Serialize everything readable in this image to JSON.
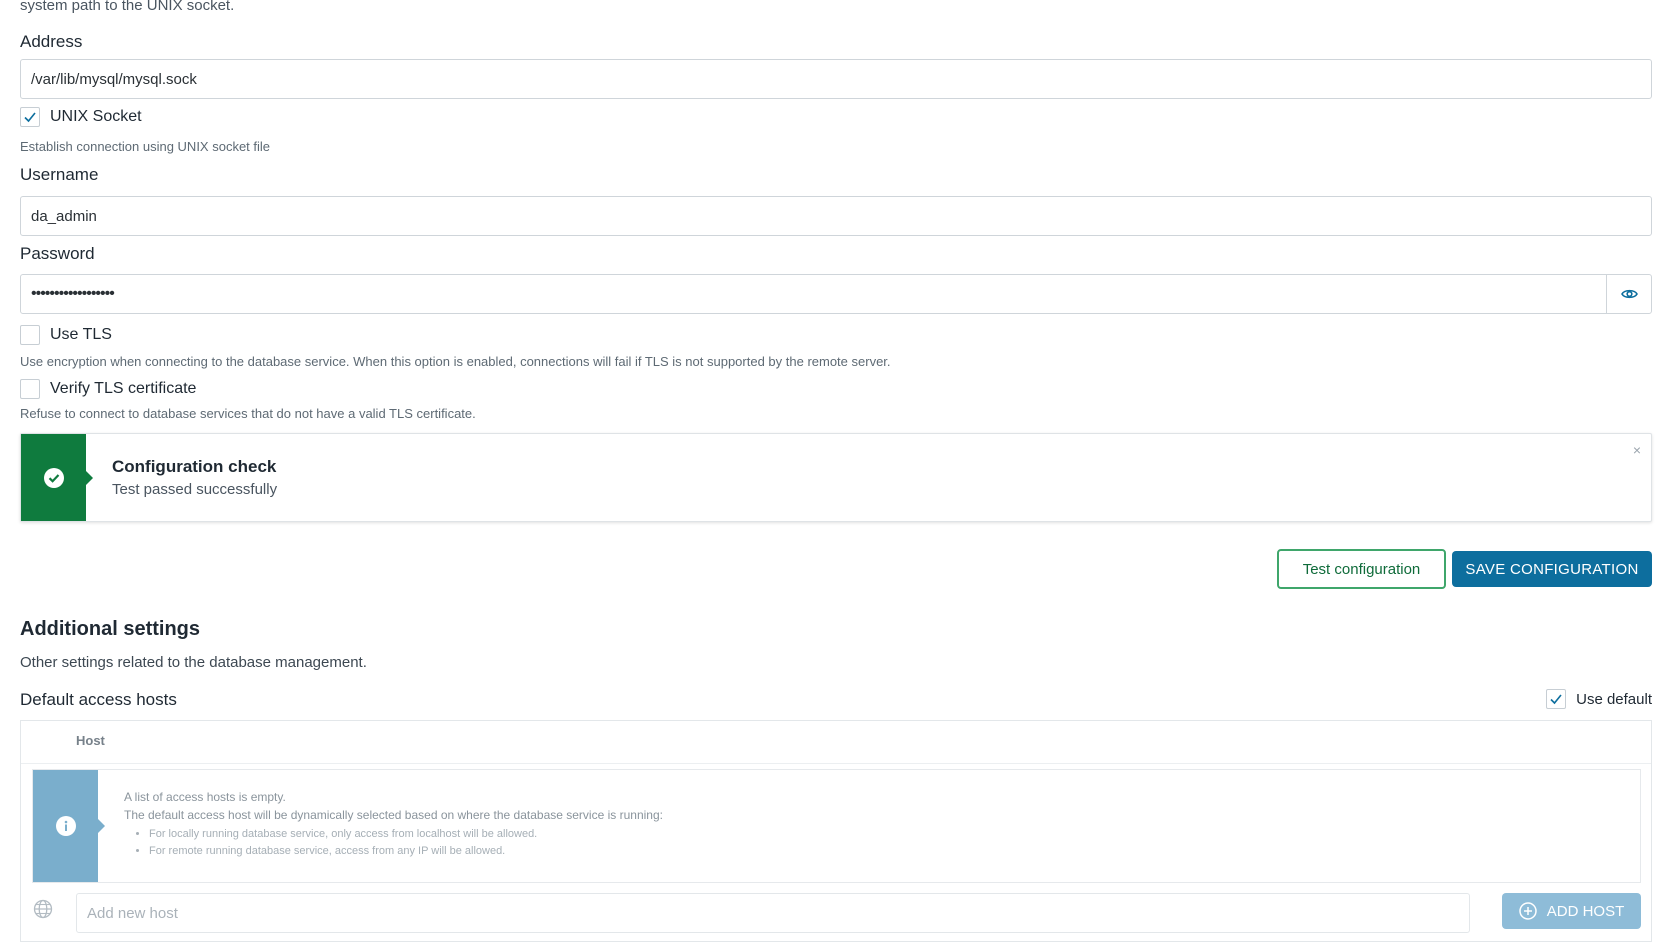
{
  "connection": {
    "intro_text": "system path to the UNIX socket.",
    "address": {
      "label": "Address",
      "value": "/var/lib/mysql/mysql.sock"
    },
    "unix_socket": {
      "label": "UNIX Socket",
      "checked": true,
      "help": "Establish connection using UNIX socket file"
    },
    "username": {
      "label": "Username",
      "value": "da_admin"
    },
    "password": {
      "label": "Password",
      "masked_value": "••••••••••••••••••"
    },
    "use_tls": {
      "label": "Use TLS",
      "checked": false,
      "help": "Use encryption when connecting to the database service. When this option is enabled, connections will fail if TLS is not supported by the remote server."
    },
    "verify_tls": {
      "label": "Verify TLS certificate",
      "checked": false,
      "help": "Refuse to connect to database services that do not have a valid TLS certificate."
    }
  },
  "notice": {
    "title": "Configuration check",
    "text": "Test passed successfully",
    "close_symbol": "×",
    "status_color": "#0f7b3e"
  },
  "actions": {
    "test_label": "Test configuration",
    "save_label": "SAVE CONFIGURATION"
  },
  "additional": {
    "title": "Additional settings",
    "description": "Other settings related to the database management.",
    "hosts_label": "Default access hosts",
    "use_default": {
      "label": "Use default",
      "checked": true
    },
    "table": {
      "column_host": "Host",
      "info_line1": "A list of access hosts is empty.",
      "info_line2": "The default access host will be dynamically selected based on where the database service is running:",
      "info_items": [
        "For locally running database service, only access from localhost will be allowed.",
        "For remote running database service, access from any IP will be allowed."
      ]
    },
    "add_host": {
      "placeholder": "Add new host",
      "button_label": "ADD HOST"
    }
  },
  "icons": [
    "check-icon",
    "eye-icon",
    "check-circle-icon",
    "close-icon",
    "info-icon",
    "globe-icon",
    "plus-circle-icon"
  ],
  "colors": {
    "primary": "#0d6e9e",
    "success": "#0f7b3e",
    "info": "#7aaecc"
  }
}
